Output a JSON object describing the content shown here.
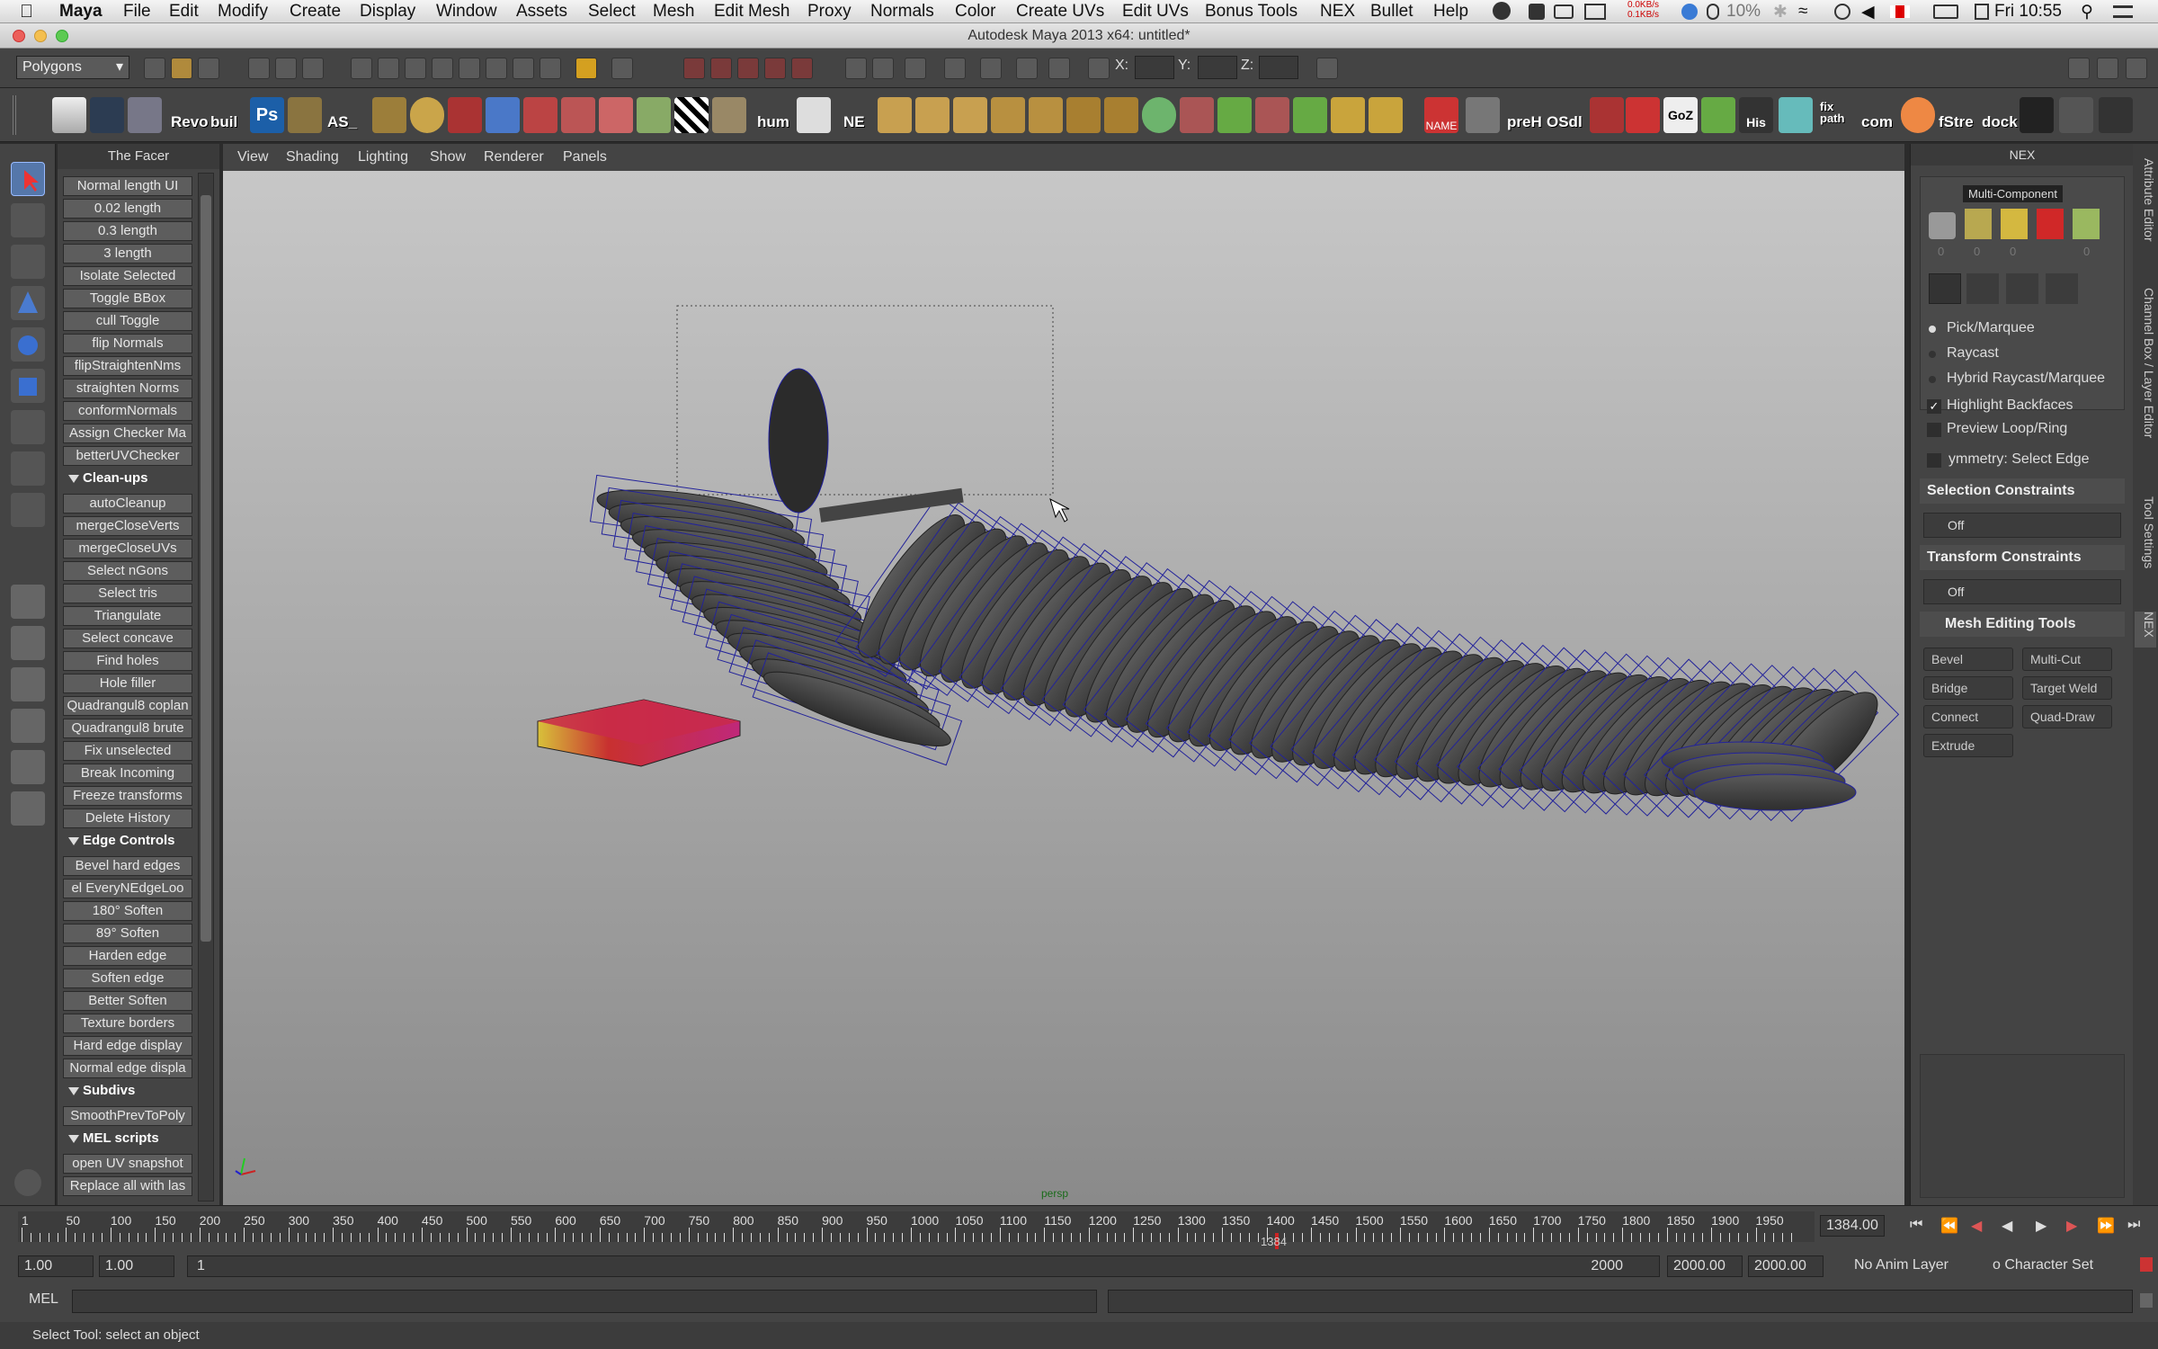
{
  "menubar": {
    "apple_icon": "apple-icon",
    "items": [
      "Maya",
      "File",
      "Edit",
      "Modify",
      "Create",
      "Display",
      "Window",
      "Assets",
      "Select",
      "Mesh",
      "Edit Mesh",
      "Proxy",
      "Normals",
      "Color",
      "Create UVs",
      "Edit UVs",
      "Bonus Tools",
      "NEX",
      "Bullet",
      "Help"
    ],
    "net_up": "0.0KB/s",
    "net_down": "0.1KB/s",
    "battery": "10%",
    "clock": "Fri 10:55"
  },
  "window": {
    "title": "Autodesk Maya 2013 x64: untitled*"
  },
  "statusline": {
    "mode": "Polygons",
    "x_label": "X:",
    "y_label": "Y:",
    "z_label": "Z:"
  },
  "shelf": {
    "labels": {
      "revo": "Revo",
      "build": "buil",
      "ps": "Ps",
      "as": "AS_",
      "hum": "hum",
      "ne": "NE",
      "name": "NAME",
      "preh": "preH",
      "osdl": "OSdl",
      "goz": "GoZ",
      "his": "His",
      "fix": "fix path",
      "com": "com",
      "fstre": "fStre",
      "dock": "dock"
    }
  },
  "facer": {
    "title": "The Facer",
    "top_buttons": [
      "Normal length UI",
      "0.02 length",
      "0.3 length",
      "3 length",
      "Isolate Selected",
      "Toggle BBox",
      "cull Toggle",
      "flip Normals",
      "flipStraightenNms",
      "straighten Norms",
      "conformNormals",
      "Assign Checker Ma",
      "betterUVChecker"
    ],
    "cleanups_header": "Clean-ups",
    "cleanups": [
      "autoCleanup",
      "mergeCloseVerts",
      "mergeCloseUVs",
      "Select nGons",
      "Select tris",
      "Triangulate",
      "Select concave",
      "Find holes",
      "Hole filler",
      "Quadrangul8 coplan",
      "Quadrangul8 brute",
      "Fix unselected",
      "Break Incoming",
      "Freeze transforms",
      "Delete History"
    ],
    "edge_header": "Edge Controls",
    "edge": [
      "Bevel hard edges",
      "el EveryNEdgeLoo",
      "180° Soften",
      "89° Soften",
      "Harden edge",
      "Soften edge",
      "Better Soften",
      "Texture borders",
      "Hard edge display",
      "Normal edge displa"
    ],
    "subdivs_header": "Subdivs",
    "subdivs": [
      "SmoothPrevToPoly"
    ],
    "mel_header": "MEL scripts",
    "mel": [
      "open UV snapshot",
      "Replace all with las"
    ]
  },
  "viewport": {
    "menu": [
      "View",
      "Shading",
      "Lighting",
      "Show",
      "Renderer",
      "Panels"
    ],
    "camera_label": "persp"
  },
  "nex": {
    "title": "NEX",
    "multi_component": "Multi-Component",
    "counts": [
      "0",
      "0",
      "0",
      "0"
    ],
    "modes": [
      "Pick/Marquee",
      "Raycast",
      "Hybrid Raycast/Marquee"
    ],
    "highlight_backfaces": "Highlight Backfaces",
    "preview_loop": "Preview Loop/Ring",
    "symmetry": "ymmetry: Select Edge",
    "selection_constraints": "Selection Constraints",
    "sel_off": "Off",
    "transform_constraints": "Transform Constraints",
    "trans_off": "Off",
    "mesh_editing": "Mesh Editing Tools",
    "tools": [
      "Bevel",
      "Multi-Cut",
      "Bridge",
      "Target Weld",
      "Connect",
      "Quad-Draw",
      "Extrude"
    ]
  },
  "right_tabs": [
    "Attribute Editor",
    "Channel Box / Layer Editor",
    "Tool Settings",
    "NEX"
  ],
  "timeslider": {
    "ticks": [
      "1",
      "50",
      "100",
      "150",
      "200",
      "250",
      "300",
      "350",
      "400",
      "450",
      "500",
      "550",
      "600",
      "650",
      "700",
      "750",
      "800",
      "850",
      "900",
      "950",
      "1000",
      "1050",
      "1100",
      "1150",
      "1200",
      "1250",
      "1300",
      "1350",
      "1400",
      "1450",
      "1500",
      "1550",
      "1600",
      "1650",
      "1700",
      "1750",
      "1800",
      "1850",
      "1900",
      "1950"
    ],
    "current_frame": "1384.00",
    "marker": "1384"
  },
  "rangeslider": {
    "start": "1.00",
    "inner_start": "1.00",
    "range_start": "1",
    "range_end": "2000",
    "end1": "2000.00",
    "end2": "2000.00",
    "anim_layer": "No Anim Layer",
    "char_set": "o Character Set"
  },
  "cmdline": {
    "label": "MEL"
  },
  "helpline": {
    "text": "Select Tool: select an object"
  }
}
